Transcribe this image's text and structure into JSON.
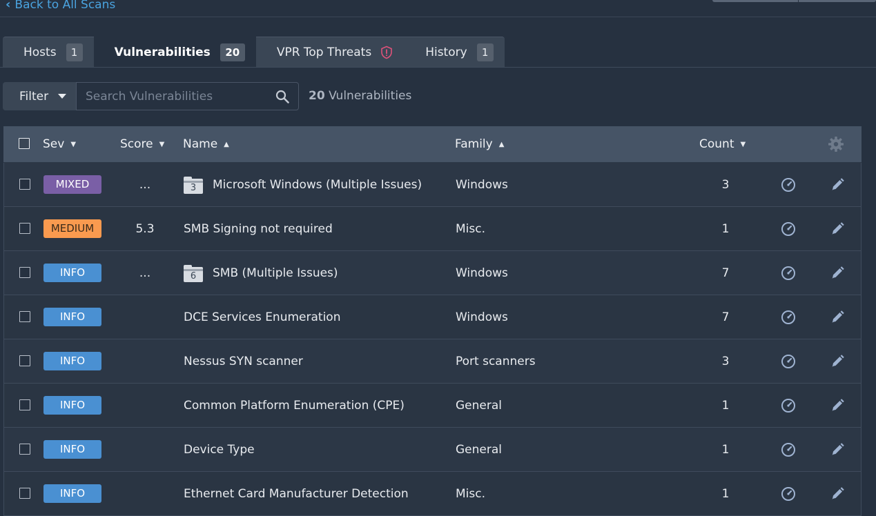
{
  "nav": {
    "back_label": "Back to All Scans"
  },
  "tabs": [
    {
      "label": "Hosts",
      "badge": "1"
    },
    {
      "label": "Vulnerabilities",
      "badge": "20"
    },
    {
      "label": "VPR Top Threats",
      "icon": "shield-alert-icon"
    },
    {
      "label": "History",
      "badge": "1"
    }
  ],
  "toolbar": {
    "filter_label": "Filter",
    "search_placeholder": "Search Vulnerabilities",
    "count_number": "20",
    "count_label": "Vulnerabilities"
  },
  "table": {
    "headers": {
      "sev": "Sev",
      "score": "Score",
      "name": "Name",
      "family": "Family",
      "count": "Count"
    },
    "sort_indicators": {
      "sev": "▼",
      "score": "▼",
      "name": "▲",
      "family": "▲",
      "count": "▼"
    },
    "rows": [
      {
        "sev": "MIXED",
        "sev_color": "#7a5fa6",
        "score": "...",
        "group_count": "3",
        "name": "Microsoft Windows (Multiple Issues)",
        "family": "Windows",
        "count": "3"
      },
      {
        "sev": "MEDIUM",
        "sev_color": "#f99a4f",
        "score": "5.3",
        "group_count": "",
        "name": "SMB Signing not required",
        "family": "Misc.",
        "count": "1"
      },
      {
        "sev": "INFO",
        "sev_color": "#4a90d2",
        "score": "...",
        "group_count": "6",
        "name": "SMB (Multiple Issues)",
        "family": "Windows",
        "count": "7"
      },
      {
        "sev": "INFO",
        "sev_color": "#4a90d2",
        "score": "",
        "group_count": "",
        "name": "DCE Services Enumeration",
        "family": "Windows",
        "count": "7"
      },
      {
        "sev": "INFO",
        "sev_color": "#4a90d2",
        "score": "",
        "group_count": "",
        "name": "Nessus SYN scanner",
        "family": "Port scanners",
        "count": "3"
      },
      {
        "sev": "INFO",
        "sev_color": "#4a90d2",
        "score": "",
        "group_count": "",
        "name": "Common Platform Enumeration (CPE)",
        "family": "General",
        "count": "1"
      },
      {
        "sev": "INFO",
        "sev_color": "#4a90d2",
        "score": "",
        "group_count": "",
        "name": "Device Type",
        "family": "General",
        "count": "1"
      },
      {
        "sev": "INFO",
        "sev_color": "#4a90d2",
        "score": "",
        "group_count": "",
        "name": "Ethernet Card Manufacturer Detection",
        "family": "Misc.",
        "count": "1"
      }
    ]
  }
}
